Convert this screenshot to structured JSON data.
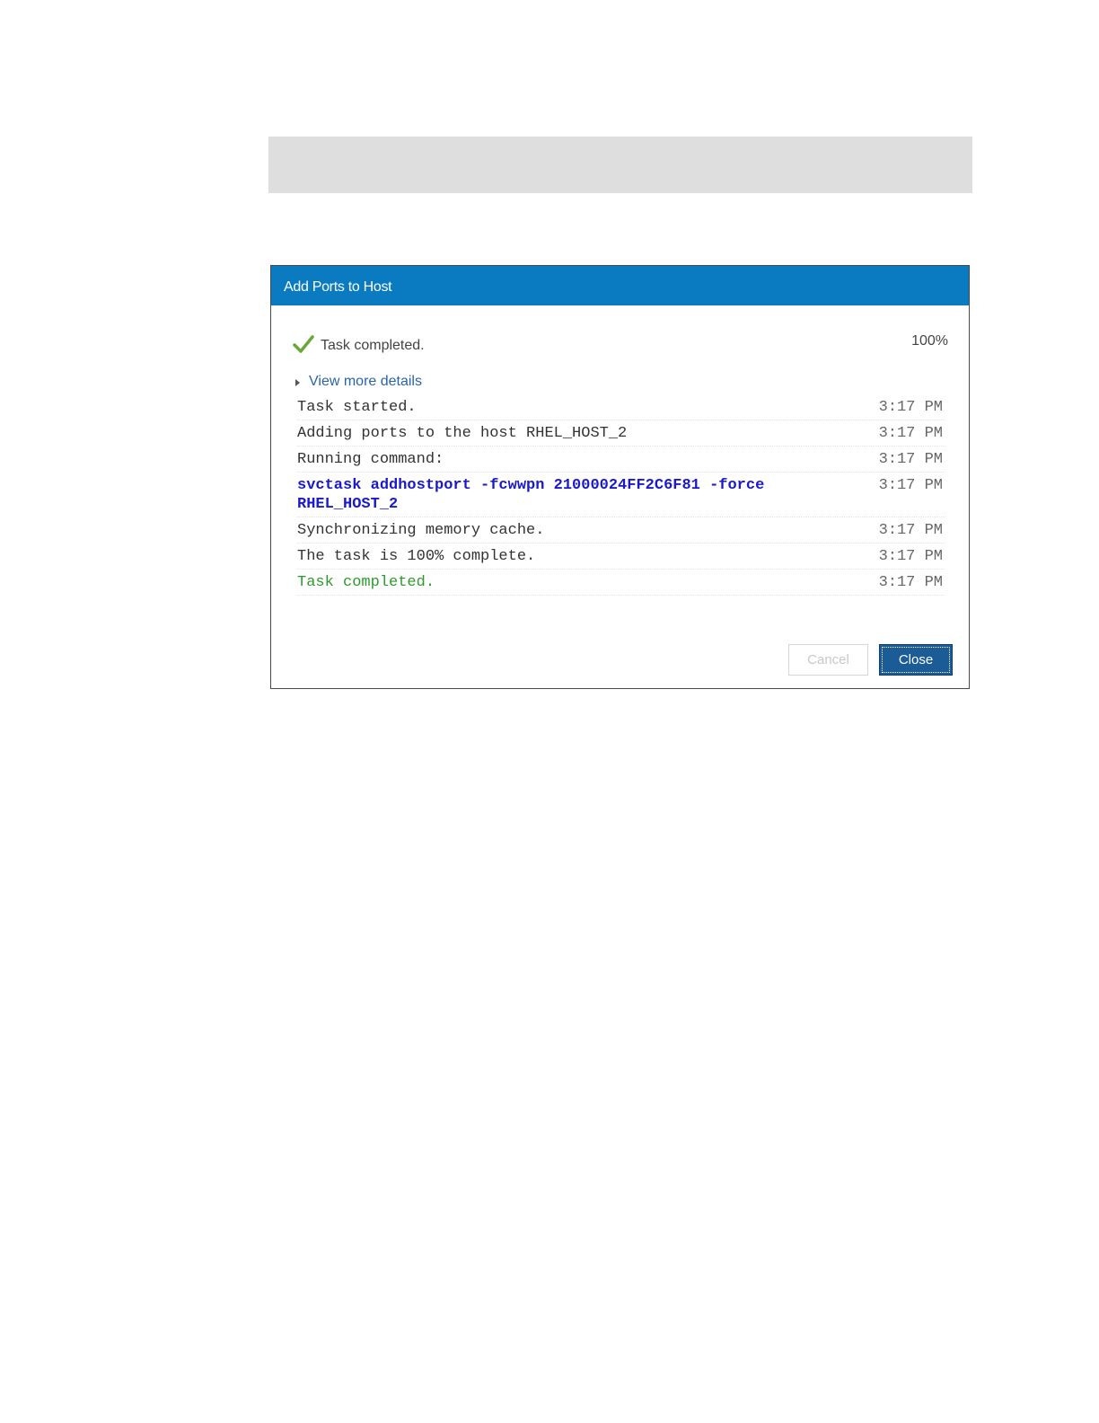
{
  "dialog": {
    "title": "Add Ports to Host",
    "status": "Task completed.",
    "progress_label": "100%",
    "progress_fraction": 1.0,
    "details_label": "View more details",
    "log": [
      {
        "message": "Task started.",
        "time": "3:17 PM",
        "kind": "normal"
      },
      {
        "message": "Adding ports to the host RHEL_HOST_2",
        "time": "3:17 PM",
        "kind": "normal"
      },
      {
        "message": "Running command:",
        "time": "3:17 PM",
        "kind": "normal"
      },
      {
        "message": "svctask addhostport -fcwwpn 21000024FF2C6F81 -force RHEL_HOST_2",
        "time": "3:17 PM",
        "kind": "command"
      },
      {
        "message": "Synchronizing memory cache.",
        "time": "3:17 PM",
        "kind": "normal"
      },
      {
        "message": "The task is 100% complete.",
        "time": "3:17 PM",
        "kind": "normal"
      },
      {
        "message": "Task completed.",
        "time": "3:17 PM",
        "kind": "success"
      }
    ],
    "buttons": {
      "cancel_label": "Cancel",
      "close_label": "Close"
    }
  },
  "colors": {
    "header": "#0a7bc1",
    "check": "#6aa837",
    "command_text": "#1a1acc",
    "success_text": "#2e9a2e",
    "close_button": "#1b5c96"
  },
  "icons": {
    "status": "check-icon",
    "details_toggle": "triangle-right-icon"
  }
}
